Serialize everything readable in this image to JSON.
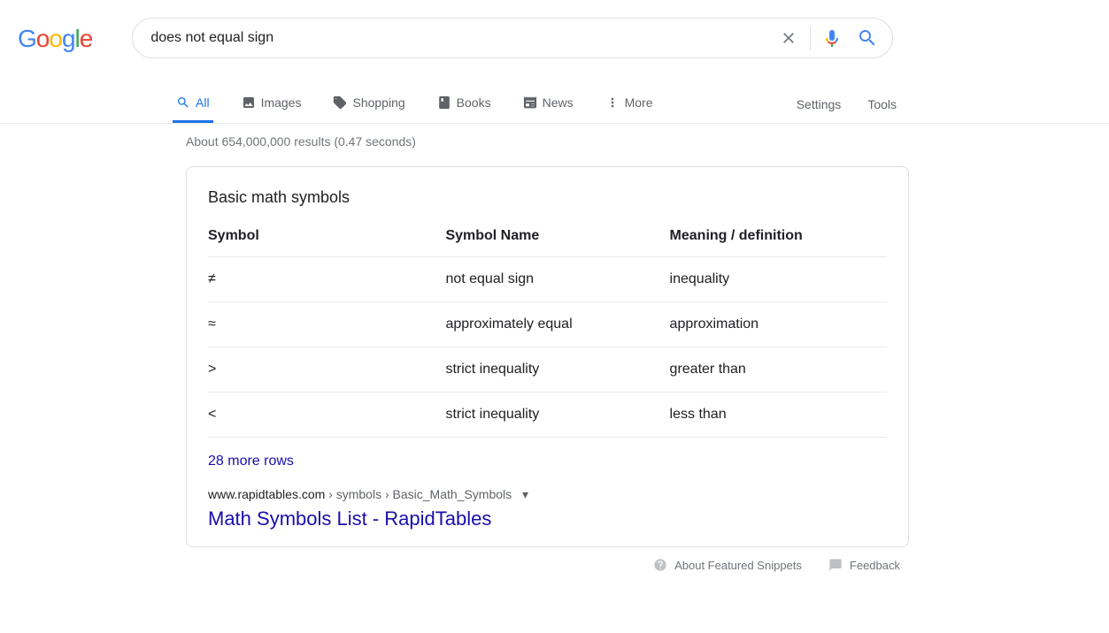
{
  "search": {
    "query": "does not equal sign"
  },
  "tabs": {
    "all": "All",
    "images": "Images",
    "shopping": "Shopping",
    "books": "Books",
    "news": "News",
    "more": "More",
    "settings": "Settings",
    "tools": "Tools"
  },
  "result_stats": "About 654,000,000 results (0.47 seconds)",
  "snippet": {
    "heading": "Basic math symbols",
    "headers": [
      "Symbol",
      "Symbol Name",
      "Meaning / definition"
    ],
    "rows": [
      {
        "symbol": "≠",
        "name": "not equal sign",
        "meaning": "inequality"
      },
      {
        "symbol": "≈",
        "name": "approximately equal",
        "meaning": "approximation"
      },
      {
        "symbol": ">",
        "name": "strict inequality",
        "meaning": "greater than"
      },
      {
        "symbol": "<",
        "name": "strict inequality",
        "meaning": "less than"
      }
    ],
    "more_rows": "28 more rows",
    "cite_domain": "www.rapidtables.com",
    "cite_path": " › symbols › Basic_Math_Symbols",
    "result_title": "Math Symbols List - RapidTables"
  },
  "footer": {
    "about": "About Featured Snippets",
    "feedback": "Feedback"
  }
}
